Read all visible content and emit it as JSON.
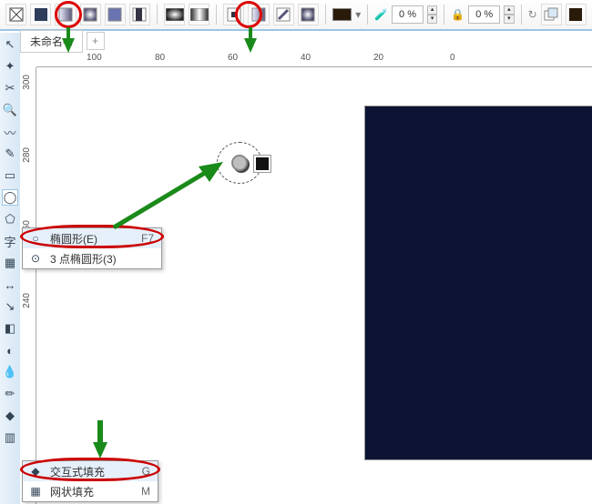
{
  "tabs": {
    "active": "未命名-1",
    "add": "+"
  },
  "toolbar": {
    "pct1": "0 %",
    "pct2": "0 %"
  },
  "ruler_h": [
    "100",
    "80",
    "60",
    "40",
    "20",
    "0"
  ],
  "ruler_v": [
    "300",
    "280",
    "260",
    "240"
  ],
  "ellipse_flyout": {
    "items": [
      {
        "icon": "○",
        "label": "椭圆形(E)",
        "shortcut": "F7"
      },
      {
        "icon": "⊙",
        "label": "3 点椭圆形(3)",
        "shortcut": ""
      }
    ]
  },
  "fill_flyout": {
    "items": [
      {
        "icon": "◆",
        "label": "交互式填充",
        "shortcut": "G"
      },
      {
        "icon": "▦",
        "label": "网状填充",
        "shortcut": "M"
      }
    ]
  }
}
